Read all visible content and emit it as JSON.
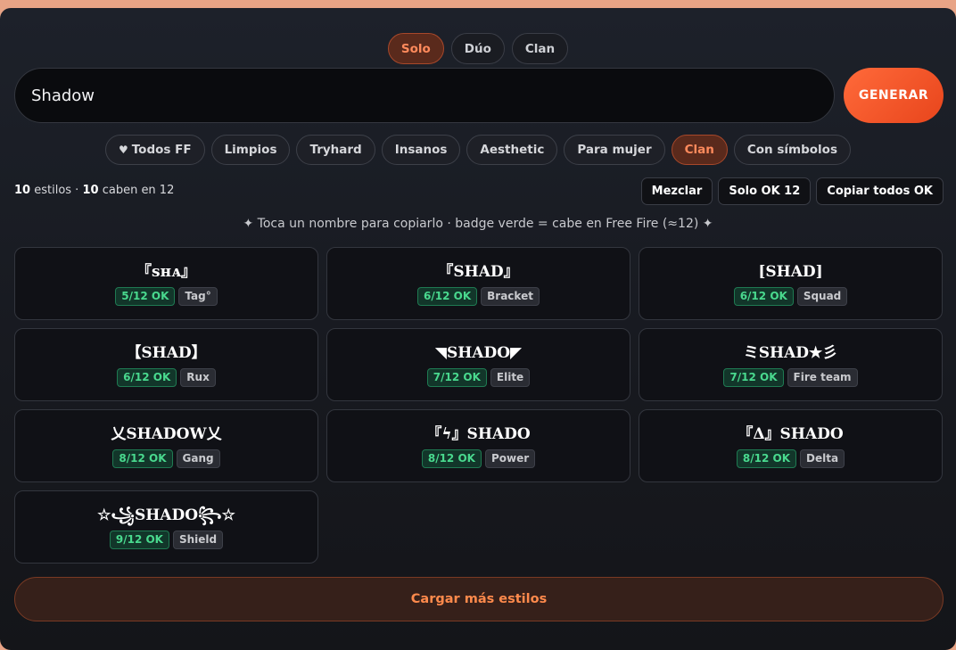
{
  "tabs": [
    {
      "label": "Solo",
      "active": true
    },
    {
      "label": "Dúo",
      "active": false
    },
    {
      "label": "Clan",
      "active": false
    }
  ],
  "search": {
    "value": "Shadow",
    "placeholder": ""
  },
  "generate_label": "GENERAR",
  "chips": [
    {
      "label": "Todos FF",
      "icon": "heart-icon",
      "active": false
    },
    {
      "label": "Limpios",
      "active": false
    },
    {
      "label": "Tryhard",
      "active": false
    },
    {
      "label": "Insanos",
      "active": false
    },
    {
      "label": "Aesthetic",
      "active": false
    },
    {
      "label": "Para mujer",
      "active": false
    },
    {
      "label": "Clan",
      "active": true
    },
    {
      "label": "Con símbolos",
      "active": false
    }
  ],
  "stats": {
    "count": "10",
    "count_text": "estilos ·",
    "fit": "10",
    "fit_text": "caben en 12"
  },
  "actions": {
    "shuffle": "Mezclar",
    "only_ok": "Solo OK 12",
    "copy_all": "Copiar todos OK"
  },
  "hint": "✦ Toca un nombre para copiarlo · badge verde = cabe en Free Fire (≈12) ✦",
  "cards": [
    {
      "name": "『sʜᴀ』",
      "ok": "5/12 OK",
      "tag": "Tag°"
    },
    {
      "name": "『SHAD』",
      "ok": "6/12 OK",
      "tag": "Bracket"
    },
    {
      "name": "[SHAD]",
      "ok": "6/12 OK",
      "tag": "Squad"
    },
    {
      "name": "【SHAD】",
      "ok": "6/12 OK",
      "tag": "Rux"
    },
    {
      "name": "◥SHADO◤",
      "ok": "7/12 OK",
      "tag": "Elite"
    },
    {
      "name": "ミSHAD★彡",
      "ok": "7/12 OK",
      "tag": "Fire team"
    },
    {
      "name": "乂SHADOW乂",
      "ok": "8/12 OK",
      "tag": "Gang"
    },
    {
      "name": "『ϟ』SHADO",
      "ok": "8/12 OK",
      "tag": "Power"
    },
    {
      "name": "『Δ』SHADO",
      "ok": "8/12 OK",
      "tag": "Delta"
    },
    {
      "name": "☆꧁SHADO꧂☆",
      "ok": "9/12 OK",
      "tag": "Shield"
    }
  ],
  "load_more": "Cargar más estilos",
  "colors": {
    "accent": "#ff6a3a",
    "ok_green": "#49d98e",
    "background": "#17191f"
  }
}
